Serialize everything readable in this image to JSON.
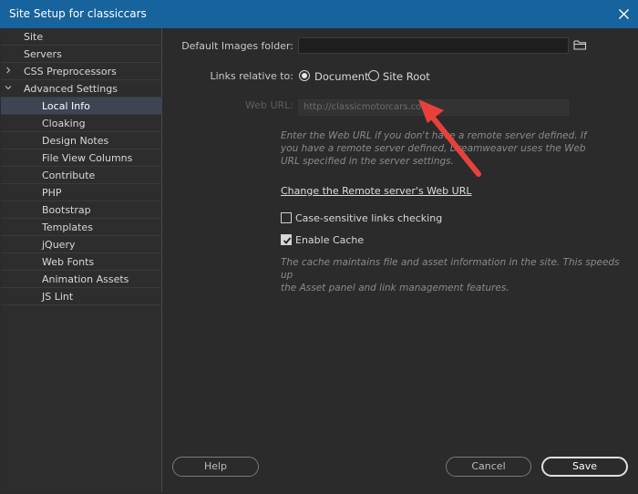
{
  "window": {
    "title": "Site Setup for classiccars"
  },
  "sidebar": {
    "items": [
      {
        "label": "Site",
        "level": 0
      },
      {
        "label": "Servers",
        "level": 0
      },
      {
        "label": "CSS Preprocessors",
        "level": 0,
        "expander": "collapsed"
      },
      {
        "label": "Advanced Settings",
        "level": 0,
        "expander": "expanded"
      },
      {
        "label": "Local Info",
        "level": 1,
        "selected": true
      },
      {
        "label": "Cloaking",
        "level": 1
      },
      {
        "label": "Design Notes",
        "level": 1
      },
      {
        "label": "File View Columns",
        "level": 1
      },
      {
        "label": "Contribute",
        "level": 1
      },
      {
        "label": "PHP",
        "level": 1
      },
      {
        "label": "Bootstrap",
        "level": 1
      },
      {
        "label": "Templates",
        "level": 1
      },
      {
        "label": "jQuery",
        "level": 1
      },
      {
        "label": "Web Fonts",
        "level": 1
      },
      {
        "label": "Animation Assets",
        "level": 1
      },
      {
        "label": "JS Lint",
        "level": 1
      }
    ]
  },
  "form": {
    "default_images_label": "Default Images folder:",
    "default_images_value": "",
    "links_relative_label": "Links relative to:",
    "radio_document": "Document",
    "radio_site_root": "Site Root",
    "selected_radio": "Document",
    "web_url_label": "Web URL:",
    "web_url_value": "http://classicmotorcars.com",
    "web_url_help": [
      "Enter the Web URL if you don't have a remote server defined. If",
      "you have a remote server defined, Dreamweaver uses the Web",
      "URL specified in the server settings."
    ],
    "change_link": "Change the Remote server's Web URL",
    "case_sensitive_label": "Case-sensitive links checking",
    "case_sensitive_checked": false,
    "enable_cache_label": "Enable Cache",
    "enable_cache_checked": true,
    "cache_help": [
      "The cache maintains file and asset information in the site. This speeds up",
      "the Asset panel and link management features."
    ]
  },
  "buttons": {
    "help": "Help",
    "cancel": "Cancel",
    "save": "Save"
  },
  "annotation": {
    "arrow_color": "#e8413c"
  },
  "colors": {
    "titlebar": "#17639d",
    "selected_item": "#3d4553"
  }
}
